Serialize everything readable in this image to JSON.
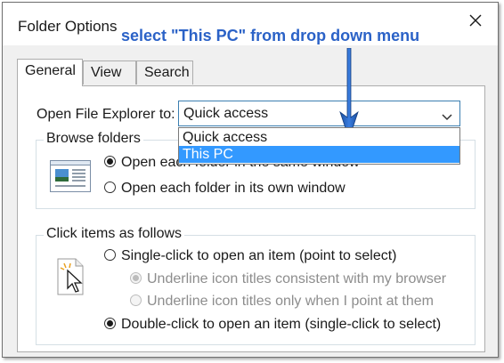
{
  "window": {
    "title": "Folder Options",
    "close_icon": "close-icon"
  },
  "annotation": {
    "text": "select \"This PC\" from drop down menu",
    "color": "#2b62c7"
  },
  "tabs": [
    {
      "label": "General",
      "active": true
    },
    {
      "label": "View",
      "active": false
    },
    {
      "label": "Search",
      "active": false
    }
  ],
  "general": {
    "open_explorer_label": "Open File Explorer to:",
    "open_explorer_value": "Quick access",
    "dropdown_options": [
      {
        "label": "Quick access",
        "selected": false
      },
      {
        "label": "This PC",
        "selected": true
      }
    ],
    "browse_folders": {
      "label": "Browse folders",
      "icon": "folder-window-icon",
      "options": [
        {
          "label": "Open each folder in the same window",
          "checked": true
        },
        {
          "label": "Open each folder in its own window",
          "checked": false
        }
      ]
    },
    "click_items": {
      "label": "Click items as follows",
      "icon": "pointer-click-icon",
      "options": [
        {
          "label": "Single-click to open an item (point to select)",
          "checked": false,
          "disabled": false
        },
        {
          "label": "Underline icon titles consistent with my browser",
          "checked": true,
          "disabled": true
        },
        {
          "label": "Underline icon titles only when I point at them",
          "checked": false,
          "disabled": true
        },
        {
          "label": "Double-click to open an item (single-click to select)",
          "checked": true,
          "disabled": false
        }
      ]
    }
  },
  "colors": {
    "selection": "#3399ff",
    "accent_border": "#3c7fb1",
    "arrow": "#1f5fbf"
  }
}
